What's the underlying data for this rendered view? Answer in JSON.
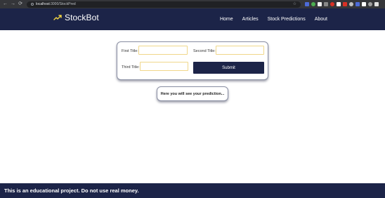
{
  "browser": {
    "back_glyph": "←",
    "forward_glyph": "→",
    "reload_glyph": "⟳",
    "url_host": "localhost",
    "url_path": ":3000/StockPred",
    "star_glyph": "☆",
    "extension_colors": [
      "#4d6bd8",
      "#4caf50",
      "#f0f0f0",
      "#888888",
      "#d93025",
      "#ffffff",
      "#d93025",
      "#c0c0c0",
      "#4d6bd8",
      "#ffffff",
      "#a0a0a0",
      "#e0e0e0"
    ]
  },
  "navbar": {
    "brand_icon": "trending-up-icon",
    "brand_icon_color": "#f5d742",
    "brand_name": "StockBot",
    "links": [
      "Home",
      "Articles",
      "Stock Predictions",
      "About"
    ]
  },
  "form": {
    "first_title_label": "First Title:",
    "first_title_value": "",
    "second_title_label": "Second Title:",
    "second_title_value": "",
    "third_title_label": "Third Title:",
    "third_title_value": "",
    "submit_label": "Submit"
  },
  "prediction": {
    "text": "Here you will see your prediction..."
  },
  "footer": {
    "text": "This is an educational project. Do not use real money."
  },
  "colors": {
    "primary": "#1c2448",
    "input_border": "#f0d78a"
  }
}
